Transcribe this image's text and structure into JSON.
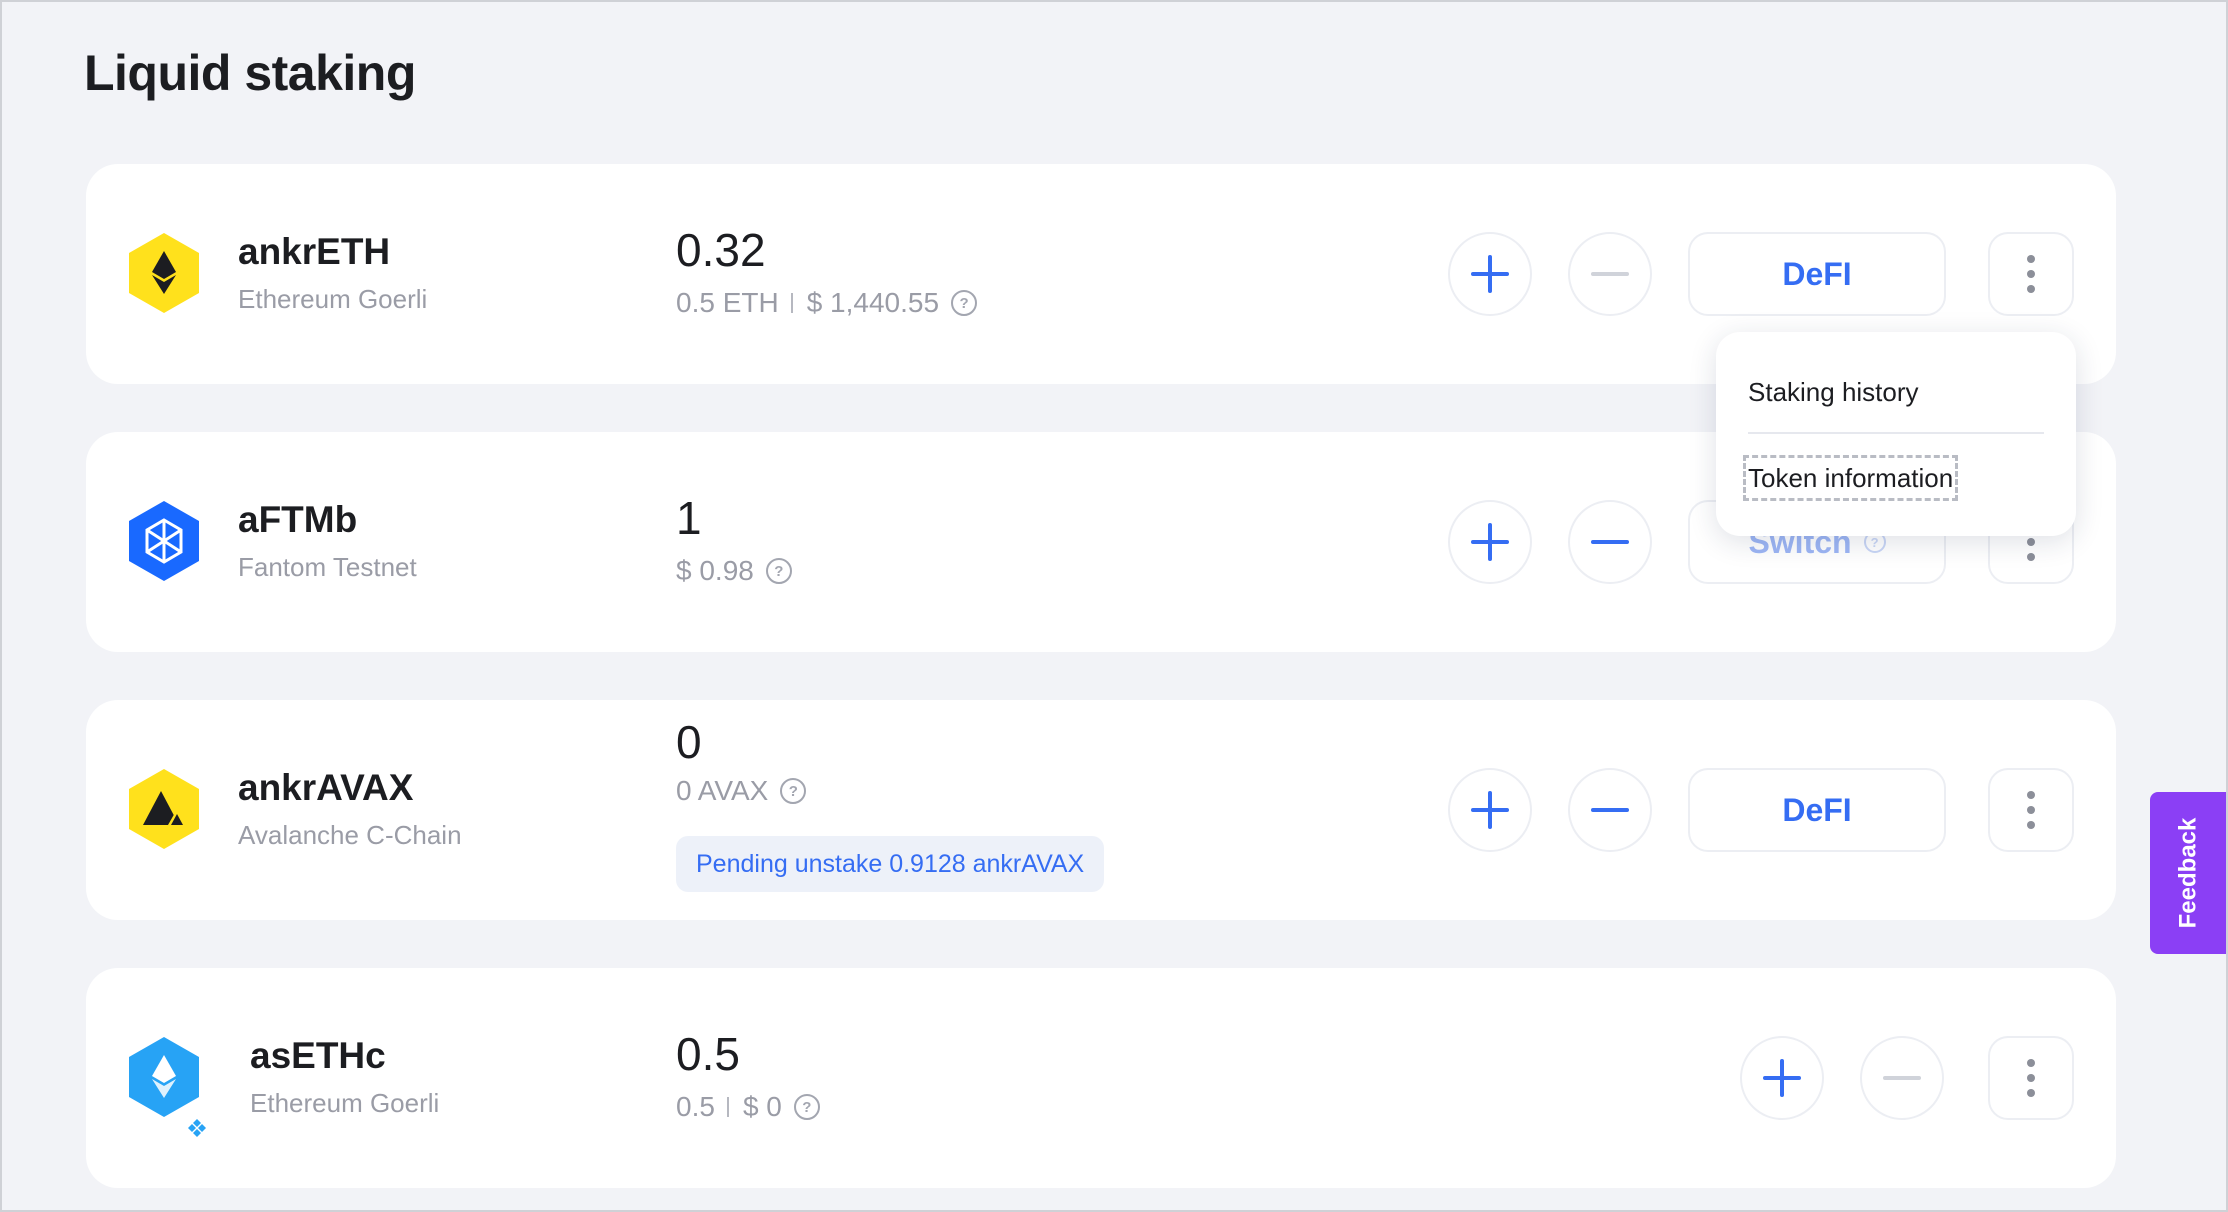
{
  "page": {
    "title": "Liquid staking"
  },
  "tokens": [
    {
      "name": "ankrETH",
      "network": "Ethereum Goerli",
      "amount": "0.32",
      "sub_primary": "0.5 ETH",
      "sub_secondary": "$ 1,440.55",
      "action_label": "DeFI",
      "icon": "ethereum-icon",
      "icon_color": "#ffe11c",
      "unstake_enabled": false
    },
    {
      "name": "aFTMb",
      "network": "Fantom Testnet",
      "amount": "1",
      "sub_primary": "$ 0.98",
      "action_label": "Switch",
      "icon": "fantom-icon",
      "icon_color": "#1969ff",
      "unstake_enabled": true
    },
    {
      "name": "ankrAVAX",
      "network": "Avalanche C-Chain",
      "amount": "0",
      "sub_primary": "0 AVAX",
      "pending": "Pending unstake 0.9128 ankrAVAX",
      "action_label": "DeFI",
      "icon": "avalanche-icon",
      "icon_color": "#ffe11c",
      "unstake_enabled": true
    },
    {
      "name": "asETHc",
      "network": "Ethereum Goerli",
      "amount": "0.5",
      "sub_primary": "0.5",
      "sub_secondary": "$ 0",
      "icon": "ethereum-icon",
      "icon_color": "#27a3f5",
      "unstake_enabled": false
    }
  ],
  "dropdown": {
    "items": [
      "Staking history",
      "Token information"
    ]
  },
  "feedback": {
    "label": "Feedback"
  },
  "colors": {
    "accent": "#356df3",
    "feedback": "#8b3ff5",
    "background": "#f2f3f7"
  }
}
